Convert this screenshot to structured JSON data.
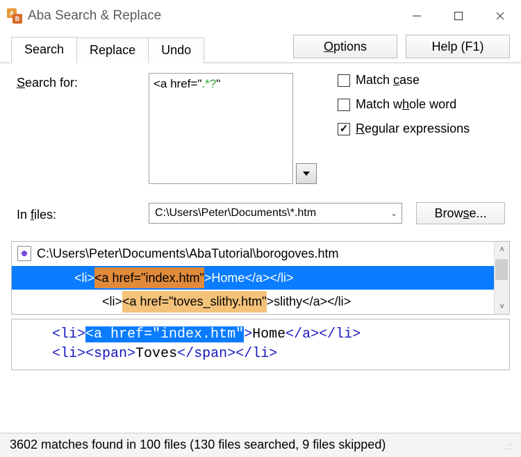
{
  "titlebar": {
    "title": "Aba Search & Replace"
  },
  "tabs": {
    "search": "Search",
    "replace": "Replace",
    "undo": "Undo"
  },
  "buttons": {
    "options_pre": "",
    "options_u": "O",
    "options_post": "ptions",
    "help": "Help (F1)",
    "browse_pre": "Brow",
    "browse_u": "s",
    "browse_post": "e..."
  },
  "form": {
    "search_label_u": "S",
    "search_label_post": "earch for:",
    "in_files_pre": "In ",
    "in_files_u": "f",
    "in_files_post": "iles:",
    "files_path": "C:\\Users\\Peter\\Documents\\*.htm",
    "search_prefix": "<a href=\"",
    "search_regex": ".*?",
    "search_suffix": "\""
  },
  "checks": {
    "case_pre": "Match ",
    "case_u": "c",
    "case_post": "ase",
    "whole_pre": "Match w",
    "whole_u": "h",
    "whole_post": "ole word",
    "regex_u": "R",
    "regex_post": "egular expressions"
  },
  "results": {
    "file": "C:\\Users\\Peter\\Documents\\AbaTutorial\\borogoves.htm",
    "line1_pre": "<li>",
    "line1_hl": "<a href=\"index.htm\"",
    "line1_post": ">Home</a></li>",
    "line2_pre": "<li>",
    "line2_hl": "<a href=\"toves_slithy.htm\"",
    "line2_post": ">slithy</a></li>"
  },
  "preview": {
    "l1_a": "<li>",
    "l1_sel": "<a href=\"index.htm\"",
    "l1_b": ">",
    "l1_txt": "Home",
    "l1_c": "</a></li>",
    "l2_a": "<li><span>",
    "l2_txt": "Toves",
    "l2_b": "</span></li>"
  },
  "status": {
    "text": "3602 matches found in 100 files (130 files searched, 9 files skipped)"
  }
}
